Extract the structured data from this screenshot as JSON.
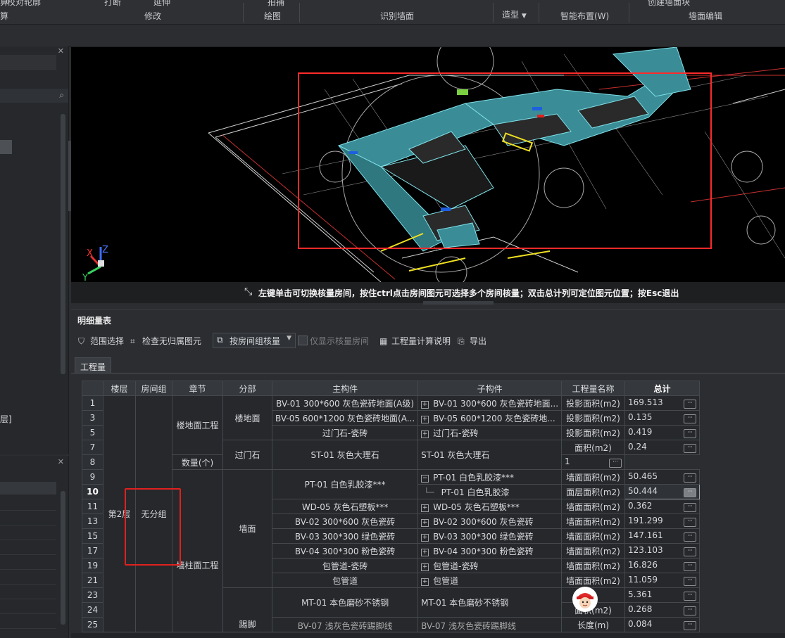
{
  "ribbon": {
    "groups": [
      "修改",
      "绘图",
      "识别墙面",
      "智能布置(W)",
      "墙面编辑"
    ],
    "left_cut": "算",
    "top_items": [
      "校对轮廓",
      "打断",
      "延伸",
      "拍捕",
      "创建墙面块"
    ],
    "dropdown": "造型"
  },
  "viewport": {
    "hint": "左键单击可切换核量房间，按住ctrl点击房间图元可选择多个房间核量；双击总计列可定位图元位置；按Esc退出",
    "axes": {
      "x": "X",
      "y": "Y",
      "z": "Z"
    }
  },
  "left_panel": {
    "cut_text": "层]"
  },
  "panel": {
    "title": "明细量表",
    "toolbar": {
      "range_select": "范围选择",
      "check_orphan": "检查无归属图元",
      "group_by": "按房间组核量",
      "only_show": "仅显示核量房间",
      "calc_desc": "工程量计算说明",
      "export": "导出"
    },
    "tab": "工程量"
  },
  "table": {
    "headers": [
      "",
      "楼层",
      "房间组",
      "章节",
      "分部",
      "主构件",
      "子构件",
      "工程量名称",
      "总计"
    ],
    "floor": "第2层",
    "room_group": "无分组",
    "chapters": [
      "楼地面工程",
      "墙柱面工程"
    ],
    "divisions": [
      "楼地面",
      "过门石",
      "墙面",
      "踢脚"
    ],
    "rows": [
      {
        "no": "1",
        "main": "BV-01 300*600 灰色瓷砖地面(A级)",
        "sub": "BV-01 300*600 灰色瓷砖地面...",
        "qty_name": "投影面积(m2)",
        "total": "169.513"
      },
      {
        "no": "3",
        "main": "BV-05 600*1200 灰色瓷砖地面(A...",
        "sub": "BV-05 600*1200 灰色瓷砖地...",
        "qty_name": "投影面积(m2)",
        "total": "0.135"
      },
      {
        "no": "5",
        "main": "过门石-瓷砖",
        "sub": "过门石-瓷砖",
        "qty_name": "投影面积(m2)",
        "total": "0.419"
      },
      {
        "no": "7",
        "main": "ST-01 灰色大理石",
        "sub": "ST-01 灰色大理石",
        "qty_name": "面积(m2)",
        "total": "0.24"
      },
      {
        "no": "8",
        "qty_name": "数量(个)",
        "total": "1"
      },
      {
        "no": "9",
        "main": "PT-01 白色乳胶漆***",
        "sub": "PT-01 白色乳胶漆***",
        "qty_name": "墙面面积(m2)",
        "total": "50.465"
      },
      {
        "no": "10",
        "sub": "PT-01 白色乳胶漆",
        "qty_name": "面层面积(m2)",
        "total": "50.444"
      },
      {
        "no": "11",
        "main": "WD-05 灰色石塑板***",
        "sub": "WD-05 灰色石塑板***",
        "qty_name": "墙面面积(m2)",
        "total": "0.362"
      },
      {
        "no": "13",
        "main": "BV-02 300*600 灰色瓷砖",
        "sub": "BV-02 300*600 灰色瓷砖",
        "qty_name": "墙面面积(m2)",
        "total": "191.299"
      },
      {
        "no": "15",
        "main": "BV-03 300*300 绿色瓷砖",
        "sub": "BV-03 300*300 绿色瓷砖",
        "qty_name": "墙面面积(m2)",
        "total": "147.161"
      },
      {
        "no": "17",
        "main": "BV-04 300*300 粉色瓷砖",
        "sub": "BV-04 300*300 粉色瓷砖",
        "qty_name": "墙面面积(m2)",
        "total": "123.103"
      },
      {
        "no": "19",
        "main": "包管道-瓷砖",
        "sub": "包管道-瓷砖",
        "qty_name": "墙面面积(m2)",
        "total": "16.826"
      },
      {
        "no": "21",
        "main": "包管道",
        "sub": "包管道",
        "qty_name": "墙面面积(m2)",
        "total": "11.059"
      },
      {
        "no": "23",
        "main": "MT-01 本色磨砂不锈钢",
        "sub": "MT-01 本色磨砂不锈钢",
        "qty_name": "",
        "total": "5.361"
      },
      {
        "no": "24",
        "qty_name": "面积(m2)",
        "total": "0.268"
      },
      {
        "no": "25",
        "main": "BV-07 浅灰色瓷砖踢脚线",
        "sub": "BV-07 浅灰色瓷砖踢脚线",
        "qty_name": "长度(m)",
        "total": "0.084"
      }
    ],
    "row_action": "···"
  }
}
